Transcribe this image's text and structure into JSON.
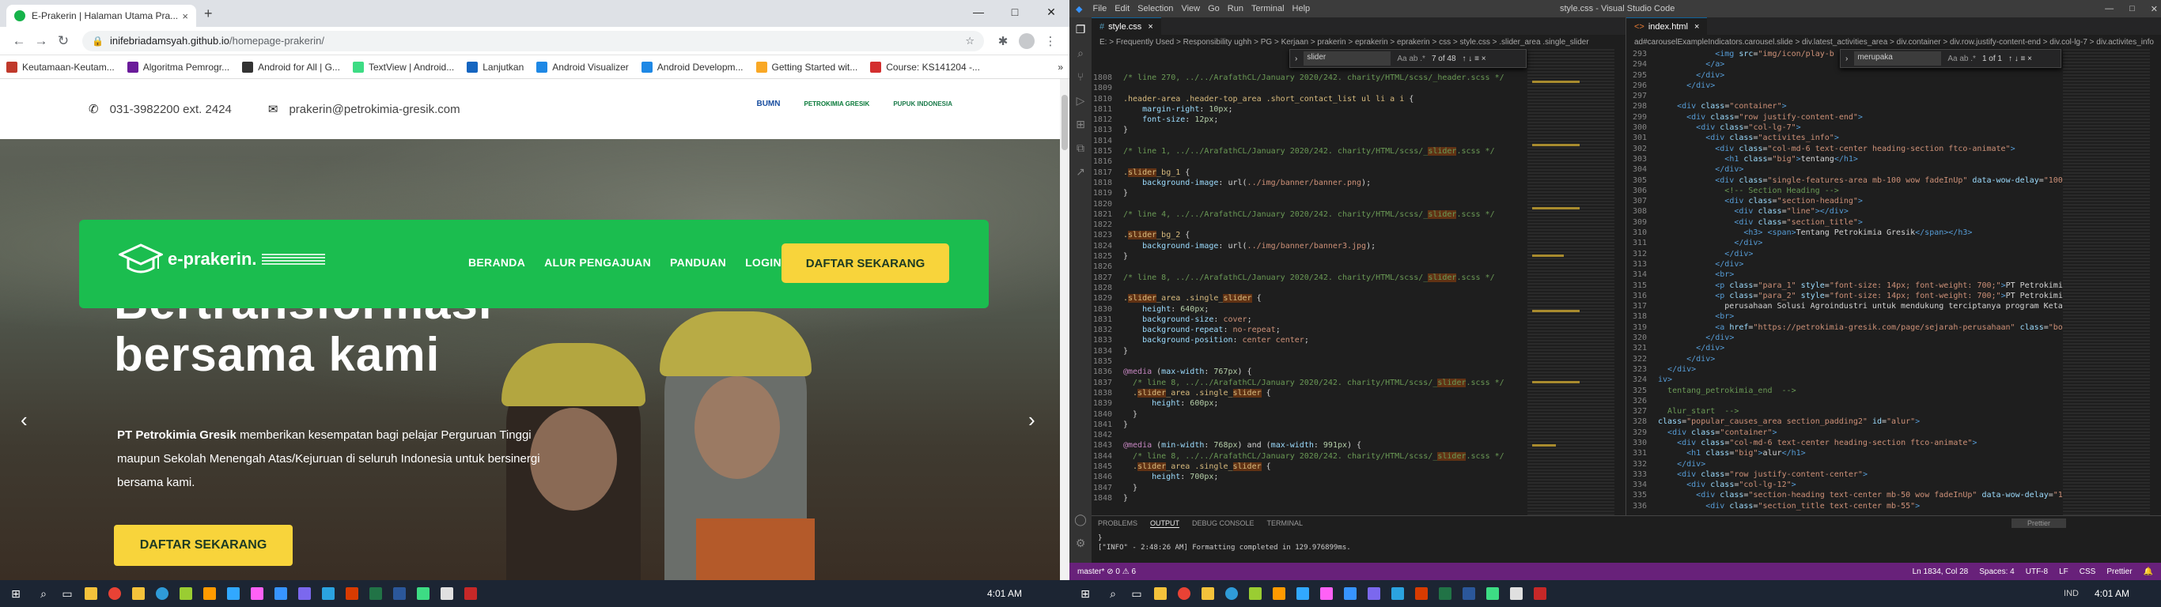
{
  "browser": {
    "tab_title": "E-Prakerin | Halaman Utama Pra...",
    "tab_close": "×",
    "new_tab": "+",
    "win_min": "—",
    "win_max": "□",
    "win_close": "✕",
    "back": "←",
    "forward": "→",
    "reload": "↻",
    "url_host": "inifebriadamsyah.github.io",
    "url_path": "/homepage-prakerin/",
    "bookmarks": [
      {
        "label": "Keutamaan-Keutam...",
        "color": "#c0392b"
      },
      {
        "label": "Algoritma Pemrogr...",
        "color": "#6a1b9a"
      },
      {
        "label": "Android for All | G...",
        "color": "#333333"
      },
      {
        "label": "TextView | Android...",
        "color": "#3ddc84"
      },
      {
        "label": "Lanjutkan",
        "color": "#1565c0"
      },
      {
        "label": "Android Visualizer",
        "color": "#1e88e5"
      },
      {
        "label": "Android Developm...",
        "color": "#1e88e5"
      },
      {
        "label": "Getting Started wit...",
        "color": "#f9a825"
      },
      {
        "label": "Course: KS141204 -...",
        "color": "#d32f2f"
      }
    ],
    "bookmarks_more": "»"
  },
  "site": {
    "phone": "031-3982200 ext. 2424",
    "email": "prakerin@petrokimia-gresik.com",
    "logos": [
      "BUMN",
      "PETROKIMIA GRESIK",
      "PUPUK INDONESIA"
    ],
    "brand": "e-prakerin.",
    "menu": [
      "BERANDA",
      "ALUR PENGAJUAN",
      "PANDUAN",
      "LOGIN"
    ],
    "cta": "DAFTAR SEKARANG",
    "hero_title_1": "Bertransformasi",
    "hero_title_2": "bersama kami",
    "hero_desc_bold": "PT Petrokimia Gresik",
    "hero_desc_rest": " memberikan kesempatan bagi pelajar Perguruan Tinggi maupun Sekolah Menengah Atas/Kejuruan di seluruh Indonesia untuk bersinergi bersama kami.",
    "hero_cta": "DAFTAR SEKARANG",
    "prev": "‹",
    "next": "›"
  },
  "vscode": {
    "menus": [
      "File",
      "Edit",
      "Selection",
      "View",
      "Go",
      "Run",
      "Terminal",
      "Help"
    ],
    "window_title": "style.css - Visual Studio Code",
    "left_tab": "style.css",
    "right_tab": "index.html",
    "left_crumbs": "E: > Frequently Used > Responsibility ughh > PG > Kerjaan > prakerin > eprakerin > eprakerin > css > style.css > .slider_area .single_slider",
    "right_crumbs": "ad#carouselExampleIndicators.carousel.slide > div.latest_activities_area > div.container > div.row.justify-content-end > div.col-lg-7 > div.activites_info",
    "find_left": "slider",
    "find_left_count": "7 of 48",
    "find_right": "merupaka",
    "find_right_count": "1 of 1",
    "left_lines": [
      {
        "n": "1808",
        "h": "<span class='cm'>/* line 270, ../../ArafathCL/January 2020/242. charity/HTML/scss/_header.scss */</span>"
      },
      {
        "n": "1809",
        "h": ""
      },
      {
        "n": "1810",
        "h": "<span class='sel'>.header-area .header-top_area .short_contact_list ul li a i</span> {"
      },
      {
        "n": "1811",
        "h": "    <span class='prop'>margin-right</span>: <span class='num'>10px</span>;"
      },
      {
        "n": "1812",
        "h": "    <span class='prop'>font-size</span>: <span class='num'>12px</span>;"
      },
      {
        "n": "1813",
        "h": "}"
      },
      {
        "n": "1814",
        "h": ""
      },
      {
        "n": "1815",
        "h": "<span class='cm'>/* line 1, ../../ArafathCL/January 2020/242. charity/HTML/scss/_<span class='mark'>slider</span>.scss */</span>"
      },
      {
        "n": "1816",
        "h": ""
      },
      {
        "n": "1817",
        "h": "<span class='sel'>.<span class='mark'>slider</span>_bg_1</span> {"
      },
      {
        "n": "1818",
        "h": "    <span class='prop'>background-image</span>: url(<span class='val'>../img/banner/banner.png</span>);"
      },
      {
        "n": "1819",
        "h": "}"
      },
      {
        "n": "1820",
        "h": ""
      },
      {
        "n": "1821",
        "h": "<span class='cm'>/* line 4, ../../ArafathCL/January 2020/242. charity/HTML/scss/_<span class='mark'>slider</span>.scss */</span>"
      },
      {
        "n": "1822",
        "h": ""
      },
      {
        "n": "1823",
        "h": "<span class='sel'>.<span class='mark'>slider</span>_bg_2</span> {"
      },
      {
        "n": "1824",
        "h": "    <span class='prop'>background-image</span>: url(<span class='val'>../img/banner/banner3.jpg</span>);"
      },
      {
        "n": "1825",
        "h": "}"
      },
      {
        "n": "1826",
        "h": ""
      },
      {
        "n": "1827",
        "h": "<span class='cm'>/* line 8, ../../ArafathCL/January 2020/242. charity/HTML/scss/_<span class='mark'>slider</span>.scss */</span>"
      },
      {
        "n": "1828",
        "h": ""
      },
      {
        "n": "1829",
        "h": "<span class='sel'>.<span class='mark'>slider</span>_area .single_<span class='mark'>slider</span></span> {"
      },
      {
        "n": "1830",
        "h": "    <span class='prop'>height</span>: <span class='num'>640px</span>;"
      },
      {
        "n": "1831",
        "h": "    <span class='prop'>background-size</span>: <span class='val'>cover</span>;"
      },
      {
        "n": "1832",
        "h": "    <span class='prop'>background-repeat</span>: <span class='val'>no-repeat</span>;"
      },
      {
        "n": "1833",
        "h": "    <span class='prop'>background-position</span>: <span class='val'>center center</span>;"
      },
      {
        "n": "1834",
        "h": "}"
      },
      {
        "n": "1835",
        "h": ""
      },
      {
        "n": "1836",
        "h": "<span class='at'>@media</span> (<span class='prop'>max-width</span>: <span class='num'>767px</span>) {"
      },
      {
        "n": "1837",
        "h": "  <span class='cm'>/* line 8, ../../ArafathCL/January 2020/242. charity/HTML/scss/_<span class='mark'>slider</span>.scss */</span>"
      },
      {
        "n": "1838",
        "h": "  <span class='sel'>.<span class='mark'>slider</span>_area .single_<span class='mark'>slider</span></span> {"
      },
      {
        "n": "1839",
        "h": "      <span class='prop'>height</span>: <span class='num'>600px</span>;"
      },
      {
        "n": "1840",
        "h": "  }"
      },
      {
        "n": "1841",
        "h": "}"
      },
      {
        "n": "1842",
        "h": ""
      },
      {
        "n": "1843",
        "h": "<span class='at'>@media</span> (<span class='prop'>min-width</span>: <span class='num'>768px</span>) and (<span class='prop'>max-width</span>: <span class='num'>991px</span>) {"
      },
      {
        "n": "1844",
        "h": "  <span class='cm'>/* line 8, ../../ArafathCL/January 2020/242. charity/HTML/scss/_<span class='mark'>slider</span>.scss */</span>"
      },
      {
        "n": "1845",
        "h": "  <span class='sel'>.<span class='mark'>slider</span>_area .single_<span class='mark'>slider</span></span> {"
      },
      {
        "n": "1846",
        "h": "      <span class='prop'>height</span>: <span class='num'>700px</span>;"
      },
      {
        "n": "1847",
        "h": "  }"
      },
      {
        "n": "1848",
        "h": "}"
      }
    ],
    "right_lines": [
      {
        "n": "293",
        "h": "            <span class='tag'>&lt;img</span> <span class='attr'>src</span>=<span class='str'>\"img/icon/play-b</span>"
      },
      {
        "n": "294",
        "h": "          <span class='tag'>&lt;/a&gt;</span>"
      },
      {
        "n": "295",
        "h": "        <span class='tag'>&lt;/div&gt;</span>"
      },
      {
        "n": "296",
        "h": "      <span class='tag'>&lt;/div&gt;</span>"
      },
      {
        "n": "297",
        "h": ""
      },
      {
        "n": "298",
        "h": "    <span class='tag'>&lt;div</span> <span class='attr'>class</span>=<span class='str'>\"container\"</span><span class='tag'>&gt;</span>"
      },
      {
        "n": "299",
        "h": "      <span class='tag'>&lt;div</span> <span class='attr'>class</span>=<span class='str'>\"row justify-content-end\"</span><span class='tag'>&gt;</span>"
      },
      {
        "n": "300",
        "h": "        <span class='tag'>&lt;div</span> <span class='attr'>class</span>=<span class='str'>\"col-lg-7\"</span><span class='tag'>&gt;</span>"
      },
      {
        "n": "301",
        "h": "          <span class='tag'>&lt;div</span> <span class='attr'>class</span>=<span class='str'>\"activites_info\"</span><span class='tag'>&gt;</span>"
      },
      {
        "n": "302",
        "h": "            <span class='tag'>&lt;div</span> <span class='attr'>class</span>=<span class='str'>\"col-md-6 text-center heading-section ftco-animate\"</span><span class='tag'>&gt;</span>"
      },
      {
        "n": "303",
        "h": "              <span class='tag'>&lt;h1</span> <span class='attr'>class</span>=<span class='str'>\"big\"</span><span class='tag'>&gt;</span>tentang<span class='tag'>&lt;/h1&gt;</span>"
      },
      {
        "n": "304",
        "h": "            <span class='tag'>&lt;/div&gt;</span>"
      },
      {
        "n": "305",
        "h": "            <span class='tag'>&lt;div</span> <span class='attr'>class</span>=<span class='str'>\"single-features-area mb-100 wow fadeInUp\"</span> <span class='attr'>data-wow-delay</span>=<span class='str'>\"100ms\"</span>"
      },
      {
        "n": "306",
        "h": "              <span class='cm'>&lt;!-- Section Heading --&gt;</span>"
      },
      {
        "n": "307",
        "h": "              <span class='tag'>&lt;div</span> <span class='attr'>class</span>=<span class='str'>\"section-heading\"</span><span class='tag'>&gt;</span>"
      },
      {
        "n": "308",
        "h": "                <span class='tag'>&lt;div</span> <span class='attr'>class</span>=<span class='str'>\"line\"</span><span class='tag'>&gt;&lt;/div&gt;</span>"
      },
      {
        "n": "309",
        "h": "                <span class='tag'>&lt;div</span> <span class='attr'>class</span>=<span class='str'>\"section_title\"</span><span class='tag'>&gt;</span>"
      },
      {
        "n": "310",
        "h": "                  <span class='tag'>&lt;h3&gt;</span> <span class='tag'>&lt;span&gt;</span>Tentang Petrokimia Gresik<span class='tag'>&lt;/span&gt;&lt;/h3&gt;</span>"
      },
      {
        "n": "311",
        "h": "                <span class='tag'>&lt;/div&gt;</span>"
      },
      {
        "n": "312",
        "h": "              <span class='tag'>&lt;/div&gt;</span>"
      },
      {
        "n": "313",
        "h": "            <span class='tag'>&lt;/div&gt;</span>"
      },
      {
        "n": "314",
        "h": "            <span class='tag'>&lt;br&gt;</span>"
      },
      {
        "n": "315",
        "h": "            <span class='tag'>&lt;p</span> <span class='attr'>class</span>=<span class='str'>\"para_1\"</span> <span class='attr'>style</span>=<span class='str'>\"font-size: 14px; font-weight: 700;\"</span><span class='tag'>&gt;</span>PT Petrokimia Gre"
      },
      {
        "n": "316",
        "h": "            <span class='tag'>&lt;p</span> <span class='attr'>class</span>=<span class='str'>\"para_2\"</span> <span class='attr'>style</span>=<span class='str'>\"font-size: 14px; font-weight: 700;\"</span><span class='tag'>&gt;</span>PT Petrokimia Gre"
      },
      {
        "n": "317",
        "h": "              perusahaan Solusi Agroindustri untuk mendukung terciptanya program Ketahan"
      },
      {
        "n": "318",
        "h": "            <span class='tag'>&lt;br&gt;</span>"
      },
      {
        "n": "319",
        "h": "            <span class='tag'>&lt;a</span> <span class='attr'>href</span>=<span class='str'>\"https://petrokimia-gresik.com/page/sejarah-perusahaan\"</span> <span class='attr'>class</span>=<span class='str'>\"boxed-b</span>"
      },
      {
        "n": "320",
        "h": "          <span class='tag'>&lt;/div&gt;</span>"
      },
      {
        "n": "321",
        "h": "        <span class='tag'>&lt;/div&gt;</span>"
      },
      {
        "n": "322",
        "h": "      <span class='tag'>&lt;/div&gt;</span>"
      },
      {
        "n": "323",
        "h": "  <span class='tag'>&lt;/div&gt;</span>"
      },
      {
        "n": "324",
        "h": "<span class='tag'>iv&gt;</span>"
      },
      {
        "n": "325",
        "h": "  <span class='cm'>tentang_petrokimia_end  --&gt;</span>"
      },
      {
        "n": "326",
        "h": ""
      },
      {
        "n": "327",
        "h": "  <span class='cm'>Alur_start  --&gt;</span>"
      },
      {
        "n": "328",
        "h": "<span class='attr'>class</span>=<span class='str'>\"popular_causes_area section_padding2\"</span> <span class='attr'>id</span>=<span class='str'>\"alur\"</span><span class='tag'>&gt;</span>"
      },
      {
        "n": "329",
        "h": "  <span class='tag'>&lt;div</span> <span class='attr'>class</span>=<span class='str'>\"container\"</span><span class='tag'>&gt;</span>"
      },
      {
        "n": "330",
        "h": "    <span class='tag'>&lt;div</span> <span class='attr'>class</span>=<span class='str'>\"col-md-6 text-center heading-section ftco-animate\"</span><span class='tag'>&gt;</span>"
      },
      {
        "n": "331",
        "h": "      <span class='tag'>&lt;h1</span> <span class='attr'>class</span>=<span class='str'>\"big\"</span><span class='tag'>&gt;</span>alur<span class='tag'>&lt;/h1&gt;</span>"
      },
      {
        "n": "332",
        "h": "    <span class='tag'>&lt;/div&gt;</span>"
      },
      {
        "n": "333",
        "h": "    <span class='tag'>&lt;div</span> <span class='attr'>class</span>=<span class='str'>\"row justify-content-center\"</span><span class='tag'>&gt;</span>"
      },
      {
        "n": "334",
        "h": "      <span class='tag'>&lt;div</span> <span class='attr'>class</span>=<span class='str'>\"col-lg-12\"</span><span class='tag'>&gt;</span>"
      },
      {
        "n": "335",
        "h": "        <span class='tag'>&lt;div</span> <span class='attr'>class</span>=<span class='str'>\"section-heading text-center mb-50 wow fadeInUp\"</span> <span class='attr'>data-wow-delay</span>=<span class='str'>\"100ms\"</span>"
      },
      {
        "n": "336",
        "h": "          <span class='tag'>&lt;div</span> <span class='attr'>class</span>=<span class='str'>\"section_title text-center mb-55\"</span><span class='tag'>&gt;</span>"
      }
    ],
    "panel_tabs": [
      "PROBLEMS",
      "OUTPUT",
      "DEBUG CONSOLE",
      "TERMINAL"
    ],
    "panel_select": "Prettier",
    "output_line_1": "}",
    "output_line_2": "[\"INFO\" - 2:48:26 AM] Formatting completed in 129.976899ms.",
    "status_left": "master*  ⊘ 0 ⚠ 6",
    "status_pos": "Ln 1834, Col 28",
    "status_spaces": "Spaces: 4",
    "status_enc": "UTF-8",
    "status_eol": "LF",
    "status_lang": "CSS",
    "status_prettier": "Prettier"
  },
  "taskbar": {
    "clock": "4:01 AM",
    "lang": "IND"
  }
}
